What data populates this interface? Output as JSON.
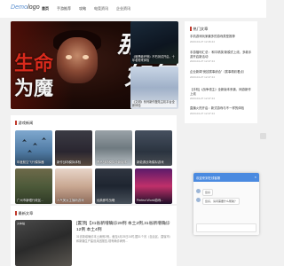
{
  "header": {
    "logo_a": "Demo",
    "logo_b": "logo",
    "nav": [
      "首页",
      "手游推荐",
      "攻略",
      "电竞资讯",
      "企业资讯"
    ]
  },
  "hero": {
    "line1_red": "生命",
    "line1_rest": "",
    "line2": "为魔",
    "right1": "那又",
    "right2": "如何"
  },
  "thumbs": [
    {
      "caption": "《暗黑破坏神》不朽测试开启，十年老粉来体验"
    },
    {
      "caption": "《文明》系列新作登陆主机平台全新体验"
    }
  ],
  "news": {
    "title": "热门文章",
    "items": [
      {
        "title": "手机游戏玩家最多的游戏类型推荐",
        "date": "2023-04-27 12:46:44"
      },
      {
        "title": "手游福利汇总：‘和平精英’新模式上线，多款手游开启新活动",
        "date": "2023-04-27 12:47:44"
      },
      {
        "title": "企业新闻“竞技赛事综合”（赛事精彩看点）",
        "date": "2023-04-27 12:47:44"
      },
      {
        "title": "【手机]《战争领主》全新版本来袭，网游新作上线",
        "date": "2023-04-27 12:47:44"
      },
      {
        "title": "直播火热开启：新式游戏与不一样的体验",
        "date": "2023-04-27 12:47:44"
      }
    ]
  },
  "game_news": {
    "title": "游戏新闻",
    "cards": [
      {
        "caption": "年度航空飞行模拟器"
      },
      {
        "caption": "新作战场模拟体验"
      },
      {
        "caption": "青马战场模拟全新版本"
      },
      {
        "caption": "新能源战场模拟游戏"
      },
      {
        "caption": "广州市新帽行政区..."
      },
      {
        "caption": "人气美女主播新游戏"
      },
      {
        "caption": "经典即时战略"
      },
      {
        "caption": "Perfect World游戏..."
      }
    ]
  },
  "latest": {
    "title": "最新文章",
    "thumb_caption": "火车站",
    "headline": "[置顶]【31省新增确诊29例 本土2例,31省新增确诊12例 本土4例",
    "body": "31省新增确诊本土病例2例。截至4月25日24时,据31个省（自治区、直辖市）和新疆生产建设兵团报告,现有确诊病例..."
  },
  "chat": {
    "title": "欢迎来到在线客服",
    "close": "×",
    "messages": [
      "您好",
      "您好，请问需要什么帮助？"
    ]
  }
}
